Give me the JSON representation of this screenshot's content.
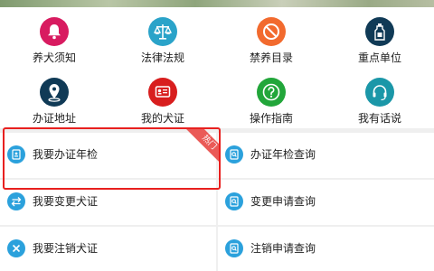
{
  "grid": {
    "items": [
      {
        "label": "养犬须知",
        "icon": "bell-icon",
        "color": "#d81b60"
      },
      {
        "label": "法律法规",
        "icon": "scales-icon",
        "color": "#2aa3c9"
      },
      {
        "label": "禁养目录",
        "icon": "no-sign-icon",
        "color": "#f26a2e"
      },
      {
        "label": "重点单位",
        "icon": "bottle-icon",
        "color": "#103a56"
      },
      {
        "label": "办证地址",
        "icon": "location-pin-icon",
        "color": "#103a56"
      },
      {
        "label": "我的犬证",
        "icon": "id-card-icon",
        "color": "#d81e1e"
      },
      {
        "label": "操作指南",
        "icon": "question-icon",
        "color": "#22a63a"
      },
      {
        "label": "我有话说",
        "icon": "headset-icon",
        "color": "#1b97a8"
      }
    ]
  },
  "list": {
    "items": [
      {
        "label": "我要办证年检",
        "icon": "id-badge-icon"
      },
      {
        "label": "办证年检查询",
        "icon": "search-doc-icon"
      },
      {
        "label": "我要变更犬证",
        "icon": "swap-arrows-icon"
      },
      {
        "label": "变更申请查询",
        "icon": "search-doc-icon"
      },
      {
        "label": "我要注销犬证",
        "icon": "close-icon"
      },
      {
        "label": "注销申请查询",
        "icon": "search-doc-icon"
      }
    ],
    "hot_badge": "热门",
    "accent_color": "#2ba1dc",
    "highlight_color": "#e8201f"
  }
}
